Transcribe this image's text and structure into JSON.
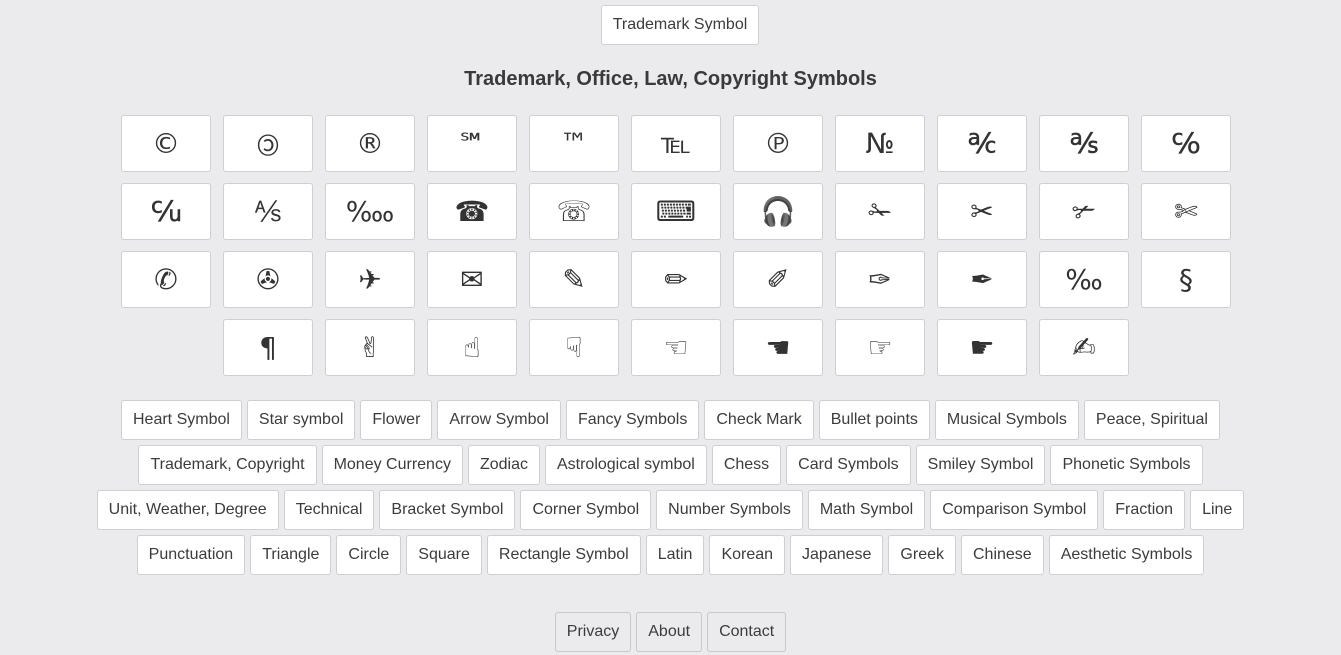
{
  "top_button": "Trademark Symbol",
  "title": "Trademark, Office, Law, Copyright Symbols",
  "symbols": [
    [
      {
        "char": "©",
        "name": "copyright-sign-icon"
      },
      {
        "char": "🄯",
        "name": "circled-c-icon"
      },
      {
        "char": "®",
        "name": "registered-sign-icon"
      },
      {
        "char": "℠",
        "name": "service-mark-icon"
      },
      {
        "char": "™",
        "name": "trademark-sign-icon"
      },
      {
        "char": "℡",
        "name": "telephone-sign-icon"
      },
      {
        "char": "℗",
        "name": "sound-recording-copyright-icon"
      },
      {
        "char": "№",
        "name": "numero-sign-icon"
      },
      {
        "char": "℀",
        "name": "account-of-icon"
      },
      {
        "char": "℁",
        "name": "addressed-to-subject-icon"
      },
      {
        "char": "℅",
        "name": "care-of-icon"
      }
    ],
    [
      {
        "char": "℆",
        "name": "cada-una-icon"
      },
      {
        "char": "⅍",
        "name": "aktieselskab-icon"
      },
      {
        "char": "‱",
        "name": "per-ten-thousand-icon"
      },
      {
        "char": "☎",
        "name": "black-telephone-icon"
      },
      {
        "char": "☏",
        "name": "white-telephone-icon"
      },
      {
        "char": "⌨",
        "name": "keyboard-icon"
      },
      {
        "char": "🎧",
        "name": "headphones-icon"
      },
      {
        "char": "✁",
        "name": "upper-blade-scissors-icon"
      },
      {
        "char": "✂",
        "name": "black-scissors-icon"
      },
      {
        "char": "✃",
        "name": "lower-blade-scissors-icon"
      },
      {
        "char": "✄",
        "name": "white-scissors-icon"
      }
    ],
    [
      {
        "char": "✆",
        "name": "telephone-location-sign-icon"
      },
      {
        "char": "✇",
        "name": "tape-drive-icon"
      },
      {
        "char": "✈",
        "name": "airplane-icon"
      },
      {
        "char": "✉",
        "name": "envelope-icon"
      },
      {
        "char": "✎",
        "name": "lower-right-pencil-icon"
      },
      {
        "char": "✏",
        "name": "pencil-icon"
      },
      {
        "char": "✐",
        "name": "upper-right-pencil-icon"
      },
      {
        "char": "✑",
        "name": "white-nib-icon"
      },
      {
        "char": "✒",
        "name": "black-nib-icon"
      },
      {
        "char": "‰",
        "name": "per-mille-sign-icon"
      },
      {
        "char": "§",
        "name": "section-sign-icon"
      }
    ],
    [
      {
        "char": "¶",
        "name": "pilcrow-sign-icon"
      },
      {
        "char": "✌",
        "name": "victory-hand-icon"
      },
      {
        "char": "☝",
        "name": "index-pointing-up-icon"
      },
      {
        "char": "☟",
        "name": "white-down-pointing-index-icon"
      },
      {
        "char": "☜",
        "name": "white-left-pointing-index-icon"
      },
      {
        "char": "☚",
        "name": "black-left-pointing-index-icon"
      },
      {
        "char": "☞",
        "name": "white-right-pointing-index-icon"
      },
      {
        "char": "☛",
        "name": "black-right-pointing-index-icon"
      },
      {
        "char": "✍",
        "name": "writing-hand-icon"
      }
    ]
  ],
  "categories": [
    [
      "Heart Symbol",
      "Star symbol",
      "Flower",
      "Arrow Symbol",
      "Fancy Symbols",
      "Check Mark",
      "Bullet points",
      "Musical Symbols",
      "Peace, Spiritual"
    ],
    [
      "Trademark, Copyright",
      "Money Currency",
      "Zodiac",
      "Astrological symbol",
      "Chess",
      "Card Symbols",
      "Smiley Symbol",
      "Phonetic Symbols"
    ],
    [
      "Unit, Weather, Degree",
      "Technical",
      "Bracket Symbol",
      "Corner Symbol",
      "Number Symbols",
      "Math Symbol",
      "Comparison Symbol",
      "Fraction",
      "Line"
    ],
    [
      "Punctuation",
      "Triangle",
      "Circle",
      "Square",
      "Rectangle Symbol",
      "Latin",
      "Korean",
      "Japanese",
      "Greek",
      "Chinese",
      "Aesthetic Symbols"
    ]
  ],
  "footer": [
    "Privacy",
    "About",
    "Contact"
  ]
}
